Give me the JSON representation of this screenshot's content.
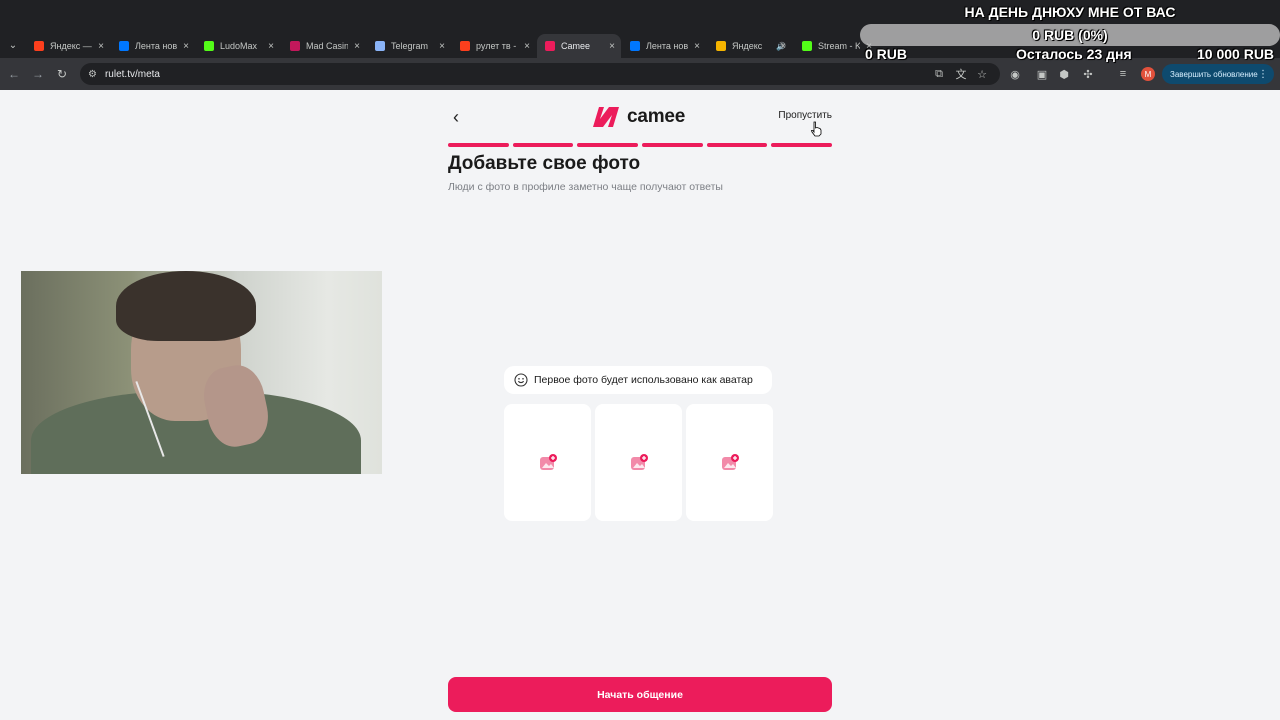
{
  "browser": {
    "tabs": [
      {
        "label": "Яндекс —",
        "favicon_color": "#fc3f1d",
        "active": false
      },
      {
        "label": "Лента нов",
        "favicon_color": "#0077ff",
        "active": false
      },
      {
        "label": "LudoMax",
        "favicon_color": "#53fc18",
        "active": false
      },
      {
        "label": "Mad Casin",
        "favicon_color": "#c2185b",
        "active": false
      },
      {
        "label": "Telegram",
        "favicon_color": "#8ab4f8",
        "active": false
      },
      {
        "label": "рулет тв -",
        "favicon_color": "#fc3f1d",
        "active": false
      },
      {
        "label": "Camee",
        "favicon_color": "#ec1c5b",
        "active": true
      },
      {
        "label": "Лента нов",
        "favicon_color": "#0077ff",
        "active": false
      },
      {
        "label": "Яндекс",
        "favicon_color": "#f5b400",
        "active": false,
        "audio": "🔊"
      },
      {
        "label": "Stream - K",
        "favicon_color": "#53fc18",
        "active": false
      }
    ],
    "tab_close": "×",
    "url": "rulet.tv/meta",
    "update_button": "Завершить обновление",
    "profile_initial": "M"
  },
  "overlay": {
    "title": "НА ДЕНЬ ДНЮХУ МНЕ ОТ ВАС",
    "progress_text": "0 RUB (0%)",
    "left_amount": "0 RUB",
    "days_left": "Осталось 23 дня",
    "goal_amount": "10 000 RUB"
  },
  "app": {
    "logo_text": "camee",
    "skip_label": "Пропустить",
    "progress_steps_total": 6,
    "progress_steps_done": 6,
    "title": "Добавьте свое фото",
    "subtitle": "Люди с фото в профиле заметно чаще получают ответы",
    "hint": "Первое фото будет использовано как аватар",
    "photo_slots": 3,
    "start_button": "Начать общение",
    "accent_color": "#ec1c5b"
  }
}
